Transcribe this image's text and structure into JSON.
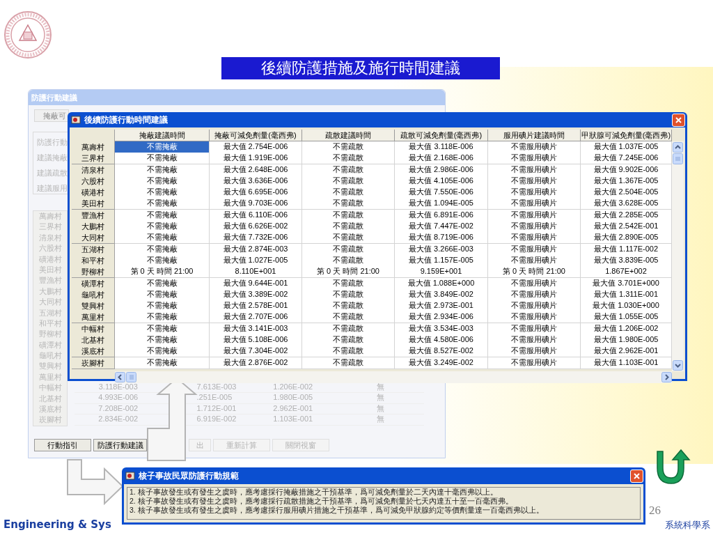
{
  "slide": {
    "title": "後續防護措施及施行時間建議",
    "footer_left": "Engineering & Sys",
    "footer_right": "系統科學系",
    "page_number": "26"
  },
  "background_window": {
    "title": "防護行動建議",
    "tab": "掩蔽可",
    "side_labels": [
      "防護行動",
      "建議掩蔽",
      "建議疏散",
      "建議服用"
    ],
    "villages": [
      "萬壽村",
      "三界村",
      "清泉村",
      "六股村",
      "磺港村",
      "美田村",
      "豐漁村",
      "大鵬村",
      "大同村",
      "五湖村",
      "和平村",
      "野柳村",
      "磺潭村",
      "龜吼村",
      "雙興村",
      "萬里村",
      "中幅村",
      "北基村",
      "溪底村",
      "崁腳村"
    ],
    "rows": [
      [
        "3.118E-003",
        "7.613E-003",
        "1.206E-002",
        "無"
      ],
      [
        "4.993E-006",
        ".251E-005",
        "1.980E-005",
        "無"
      ],
      [
        "7.208E-002",
        "1.712E-001",
        "2.962E-001",
        "無"
      ],
      [
        "2.834E-002",
        "6.919E-002",
        "1.103E-001",
        "無"
      ]
    ],
    "buttons": [
      {
        "label": "行動指引",
        "disabled": false
      },
      {
        "label": "防護行動建議",
        "disabled": false
      },
      {
        "label": "出",
        "disabled": true
      },
      {
        "label": "重新計算",
        "disabled": true
      },
      {
        "label": "關閉視窗",
        "disabled": true
      }
    ]
  },
  "front_window": {
    "title": "後續防護行動時間建議",
    "columns": [
      "掩蔽建議時間",
      "掩蔽可減免劑量(毫西弗)",
      "疏散建議時間",
      "疏散可減免劑量(毫西弗)",
      "服用碘片建議時間",
      "甲狀腺可減免劑量(毫西弗)"
    ],
    "rows": [
      {
        "village": "萬壽村",
        "selected": true,
        "cells": [
          "不需掩蔽",
          "最大值 2.754E-006",
          "不需疏散",
          "最大值 3.118E-006",
          "不需服用碘片",
          "最大值 1.037E-005"
        ]
      },
      {
        "village": "三界村",
        "selected": false,
        "cells": [
          "不需掩蔽",
          "最大值 1.919E-006",
          "不需疏散",
          "最大值 2.168E-006",
          "不需服用碘片",
          "最大值 7.245E-006"
        ]
      },
      {
        "village": "清泉村",
        "selected": false,
        "cells": [
          "不需掩蔽",
          "最大值 2.648E-006",
          "不需疏散",
          "最大值 2.986E-006",
          "不需服用碘片",
          "最大值 9.902E-006"
        ]
      },
      {
        "village": "六股村",
        "selected": false,
        "cells": [
          "不需掩蔽",
          "最大值 3.636E-006",
          "不需疏散",
          "最大值 4.105E-006",
          "不需服用碘片",
          "最大值 1.367E-005"
        ]
      },
      {
        "village": "磺港村",
        "selected": false,
        "cells": [
          "不需掩蔽",
          "最大值 6.695E-006",
          "不需疏散",
          "最大值 7.550E-006",
          "不需服用碘片",
          "最大值 2.504E-005"
        ]
      },
      {
        "village": "美田村",
        "selected": false,
        "cells": [
          "不需掩蔽",
          "最大值 9.703E-006",
          "不需疏散",
          "最大值 1.094E-005",
          "不需服用碘片",
          "最大值 3.628E-005"
        ]
      },
      {
        "village": "豐漁村",
        "selected": false,
        "cells": [
          "不需掩蔽",
          "最大值 6.110E-006",
          "不需疏散",
          "最大值 6.891E-006",
          "不需服用碘片",
          "最大值 2.285E-005"
        ]
      },
      {
        "village": "大鵬村",
        "selected": false,
        "cells": [
          "不需掩蔽",
          "最大值 6.626E-002",
          "不需疏散",
          "最大值 7.447E-002",
          "不需服用碘片",
          "最大值 2.542E-001"
        ]
      },
      {
        "village": "大同村",
        "selected": false,
        "cells": [
          "不需掩蔽",
          "最大值 7.732E-006",
          "不需疏散",
          "最大值 8.719E-006",
          "不需服用碘片",
          "最大值 2.890E-005"
        ]
      },
      {
        "village": "五湖村",
        "selected": false,
        "cells": [
          "不需掩蔽",
          "最大值 2.874E-003",
          "不需疏散",
          "最大值 3.266E-003",
          "不需服用碘片",
          "最大值 1.117E-002"
        ]
      },
      {
        "village": "和平村",
        "selected": false,
        "cells": [
          "不需掩蔽",
          "最大值 1.027E-005",
          "不需疏散",
          "最大值 1.157E-005",
          "不需服用碘片",
          "最大值 3.839E-005"
        ]
      },
      {
        "village": "野柳村",
        "selected": false,
        "cells": [
          "第 0 天 時間 21:00",
          "8.110E+001",
          "第 0 天 時間 21:00",
          "9.159E+001",
          "第 0 天 時間 21:00",
          "1.867E+002"
        ]
      },
      {
        "village": "磺潭村",
        "selected": false,
        "cells": [
          "不需掩蔽",
          "最大值 9.644E-001",
          "不需疏散",
          "最大值 1.088E+000",
          "不需服用碘片",
          "最大值 3.701E+000"
        ]
      },
      {
        "village": "龜吼村",
        "selected": false,
        "cells": [
          "不需掩蔽",
          "最大值 3.389E-002",
          "不需疏散",
          "最大值 3.849E-002",
          "不需服用碘片",
          "最大值 1.311E-001"
        ]
      },
      {
        "village": "雙興村",
        "selected": false,
        "cells": [
          "不需掩蔽",
          "最大值 2.578E-001",
          "不需疏散",
          "最大值 2.973E-001",
          "不需服用碘片",
          "最大值 1.030E+000"
        ]
      },
      {
        "village": "萬里村",
        "selected": false,
        "cells": [
          "不需掩蔽",
          "最大值 2.707E-006",
          "不需疏散",
          "最大值 2.934E-006",
          "不需服用碘片",
          "最大值 1.055E-005"
        ]
      },
      {
        "village": "中幅村",
        "selected": false,
        "cells": [
          "不需掩蔽",
          "最大值 3.141E-003",
          "不需疏散",
          "最大值 3.534E-003",
          "不需服用碘片",
          "最大值 1.206E-002"
        ]
      },
      {
        "village": "北基村",
        "selected": false,
        "cells": [
          "不需掩蔽",
          "最大值 5.108E-006",
          "不需疏散",
          "最大值 4.580E-006",
          "不需服用碘片",
          "最大值 1.980E-005"
        ]
      },
      {
        "village": "溪底村",
        "selected": false,
        "cells": [
          "不需掩蔽",
          "最大值 7.304E-002",
          "不需疏散",
          "最大值 8.527E-002",
          "不需服用碘片",
          "最大值 2.962E-001"
        ]
      },
      {
        "village": "崁腳村",
        "selected": false,
        "cells": [
          "不需掩蔽",
          "最大值 2.876E-002",
          "不需疏散",
          "最大值 3.249E-002",
          "不需服用碘片",
          "最大值 1.103E-001"
        ]
      }
    ]
  },
  "dialog": {
    "title": "核子事故民眾防護行動規範",
    "lines": [
      "1. 核子事故發生或有發生之虞時，應考慮採行掩蔽措施之干預基準，爲可減免劑量於二天內達十毫西弗以上。",
      "2. 核子事故發生或有發生之虞時，應考慮採行疏散措施之干預基準，爲可減免劑量於七天內達五十至一百毫西弗。",
      "3. 核子事故發生或有發生之虞時，應考慮採行服用碘片措施之干預基準，爲可減免甲狀腺約定等價劑量達一百毫西弗以上。"
    ]
  }
}
